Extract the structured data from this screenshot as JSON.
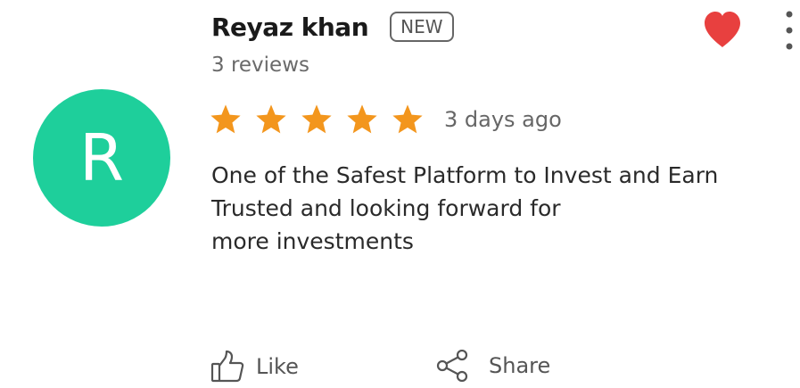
{
  "reviewer": {
    "initial": "R",
    "name": "Reyaz khan",
    "badge": "NEW",
    "reviews_count_text": "3 reviews",
    "avatar_color": "#1ecf9b"
  },
  "rating": {
    "stars": 5,
    "max_stars": 5,
    "star_color": "#f3961d",
    "date_text": "3 days ago"
  },
  "review": {
    "lines": [
      "One of the Safest Platform to Invest and Earn",
      "Trusted and looking forward for",
      "more investments"
    ]
  },
  "actions": {
    "like_label": "Like",
    "share_label": "Share"
  },
  "icons": {
    "favorite": "heart-icon",
    "favorite_color": "#e8403f",
    "menu": "more-vertical-icon",
    "like": "thumbs-up-icon",
    "share": "share-icon"
  }
}
